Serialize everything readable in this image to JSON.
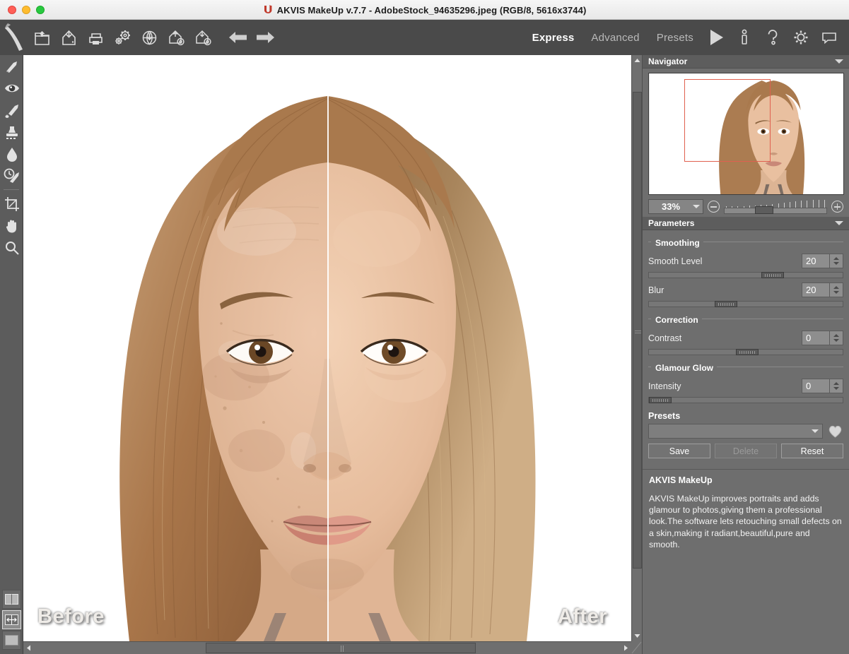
{
  "window": {
    "title": "AKVIS MakeUp v.7.7 - AdobeStock_94635296.jpeg (RGB/8, 5616x3744)",
    "controls": {
      "close": "close-button",
      "minimize": "minimize-button",
      "zoom": "maximize-button"
    }
  },
  "toolbar": {
    "items": [
      {
        "name": "open-image-button",
        "label": "Open Image"
      },
      {
        "name": "save-image-button",
        "label": "Save Image"
      },
      {
        "name": "print-image-button",
        "label": "Print Image"
      },
      {
        "name": "preferences-button",
        "label": "Preferences"
      },
      {
        "name": "publish-web-button",
        "label": "Publish Image"
      },
      {
        "name": "import-settings-button",
        "label": "Import Settings"
      },
      {
        "name": "export-settings-button",
        "label": "Export Settings"
      },
      {
        "name": "undo-button",
        "label": "Undo"
      },
      {
        "name": "redo-button",
        "label": "Redo"
      }
    ],
    "modes": [
      {
        "label": "Express",
        "active": true
      },
      {
        "label": "Advanced",
        "active": false
      },
      {
        "label": "Presets",
        "active": false
      }
    ],
    "actions": [
      {
        "name": "run-button",
        "label": "Run"
      },
      {
        "name": "about-button",
        "label": "About"
      },
      {
        "name": "help-button",
        "label": "Help"
      },
      {
        "name": "settings-button",
        "label": "Settings"
      },
      {
        "name": "comments-button",
        "label": "Comments"
      }
    ]
  },
  "left_toolbar": {
    "tools": [
      {
        "name": "smudge-tool",
        "label": "Smudge"
      },
      {
        "name": "keep-area-tool",
        "label": "Keep Area"
      },
      {
        "name": "exclusion-tool",
        "label": "Exclusion Brush"
      },
      {
        "name": "stamp-tool",
        "label": "Stamp"
      },
      {
        "name": "blur-tool",
        "label": "Blur"
      },
      {
        "name": "history-brush-tool",
        "label": "History Brush"
      },
      {
        "name": "crop-tool",
        "label": "Crop"
      },
      {
        "name": "hand-tool",
        "label": "Hand"
      },
      {
        "name": "zoom-tool",
        "label": "Zoom"
      }
    ],
    "view_modes": [
      {
        "name": "view-mode-split",
        "label": "Split View",
        "selected": false
      },
      {
        "name": "view-mode-compare",
        "label": "Compare View",
        "selected": true
      },
      {
        "name": "view-mode-single",
        "label": "Single View",
        "selected": false
      }
    ]
  },
  "canvas": {
    "before_label": "Before",
    "after_label": "After"
  },
  "navigator": {
    "title": "Navigator",
    "zoom_value": "33%",
    "zoom_minus": "Zoom Out",
    "zoom_plus": "Zoom In"
  },
  "parameters": {
    "title": "Parameters",
    "groups": [
      {
        "title": "Smoothing",
        "rows": [
          {
            "label": "Smooth Level",
            "value": "20",
            "fill": 0.6
          },
          {
            "label": "Blur",
            "value": "20",
            "fill": 0.35
          }
        ]
      },
      {
        "title": "Correction",
        "rows": [
          {
            "label": "Contrast",
            "value": "0",
            "fill": 0.47
          }
        ]
      },
      {
        "title": "Glamour Glow",
        "rows": [
          {
            "label": "Intensity",
            "value": "0",
            "fill": 0.0
          }
        ]
      }
    ]
  },
  "presets": {
    "title": "Presets",
    "selected": "",
    "favorite_icon": "heart-icon",
    "buttons": [
      {
        "label": "Save",
        "name": "preset-save-button",
        "disabled": false
      },
      {
        "label": "Delete",
        "name": "preset-delete-button",
        "disabled": true
      },
      {
        "label": "Reset",
        "name": "preset-reset-button",
        "disabled": false
      }
    ]
  },
  "info": {
    "title": "AKVIS MakeUp",
    "body": "AKVIS MakeUp improves portraits and adds glamour to photos,giving them a professional look.The software lets retouching small defects on a skin,making it radiant,beautiful,pure and smooth."
  },
  "colors": {
    "titlebar": "#f0f0f0",
    "toolbar": "#4a4a4a",
    "panel": "#6e6e6e",
    "panel_header": "#5d5d5d",
    "accent_selection": "#e0604f",
    "text": "#ffffff"
  }
}
